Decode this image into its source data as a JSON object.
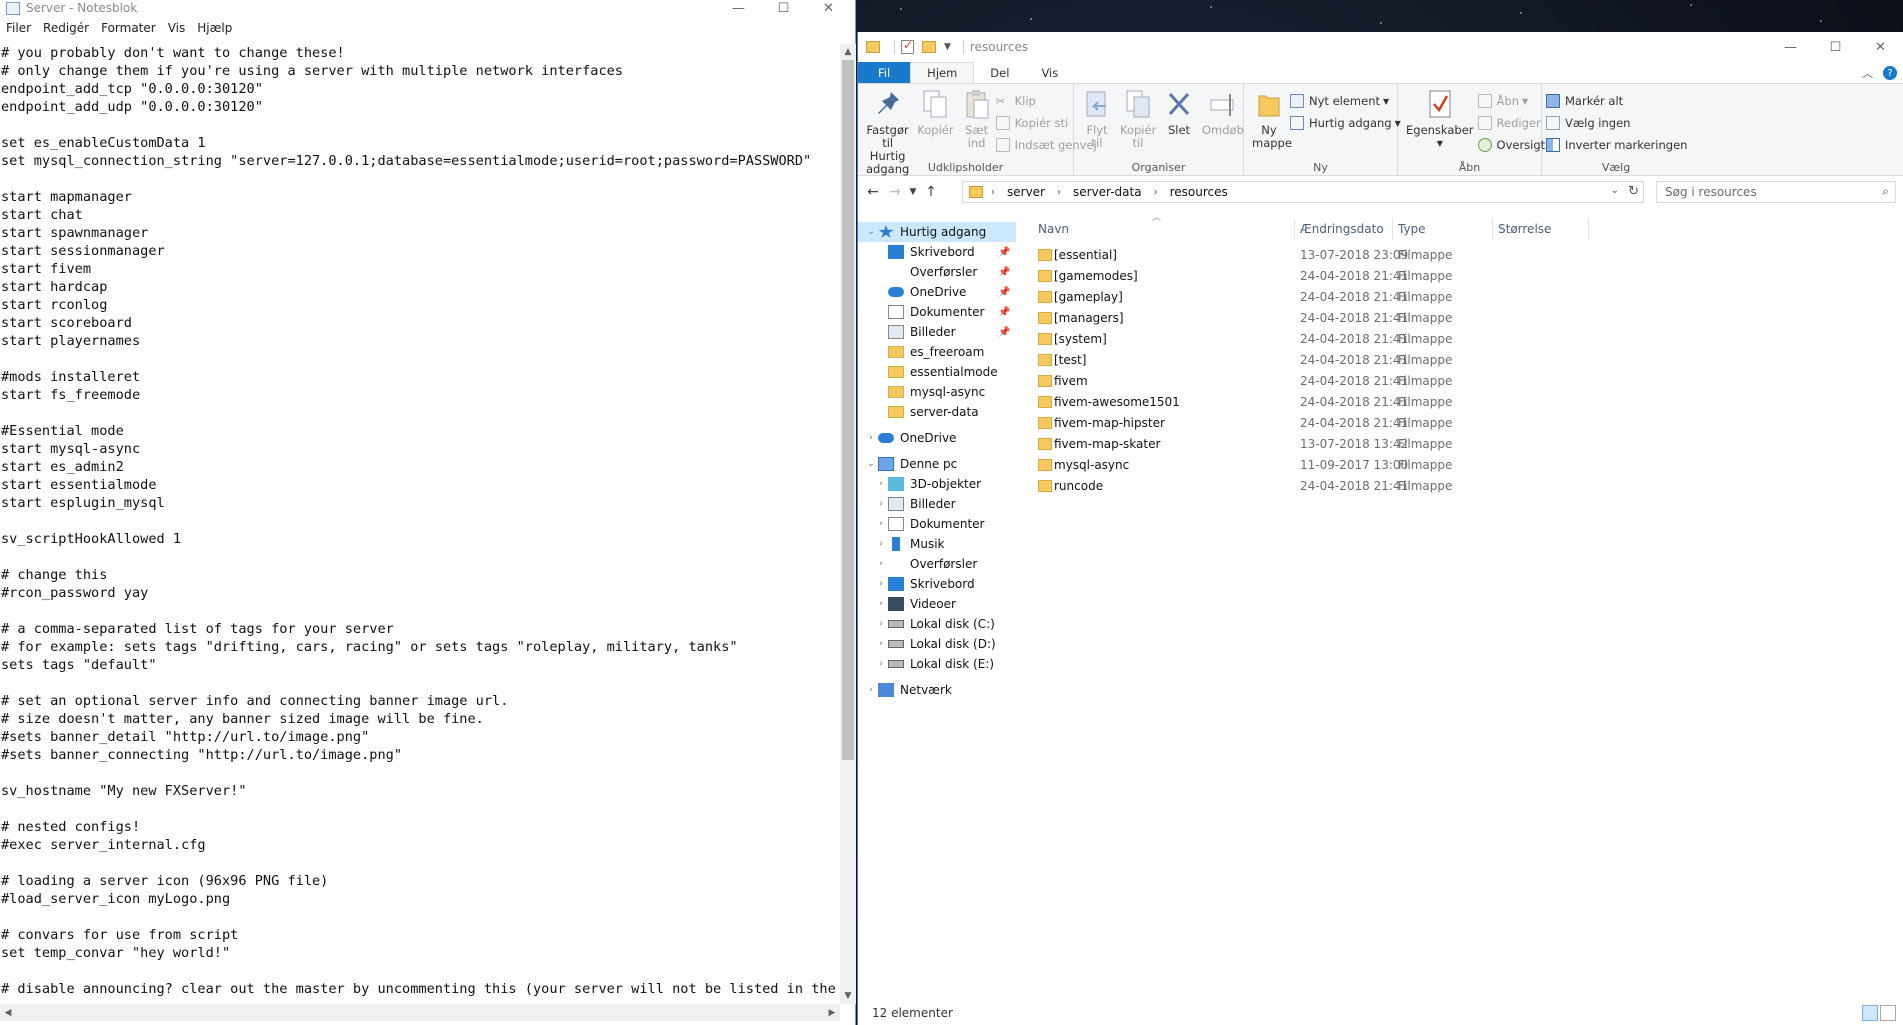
{
  "notepad": {
    "title": "Server - Notesblok",
    "menu": [
      "Filer",
      "Redigér",
      "Formater",
      "Vis",
      "Hjælp"
    ],
    "lines": [
      "# you probably don't want to change these!",
      "# only change them if you're using a server with multiple network interfaces",
      "endpoint_add_tcp \"0.0.0.0:30120\"",
      "endpoint_add_udp \"0.0.0.0:30120\"",
      "",
      "set es_enableCustomData 1",
      "set mysql_connection_string \"server=127.0.0.1;database=essentialmode;userid=root;password=PASSWORD\"",
      "",
      "start mapmanager",
      "start chat",
      "start spawnmanager",
      "start sessionmanager",
      "start fivem",
      "start hardcap",
      "start rconlog",
      "start scoreboard",
      "start playernames",
      "",
      "#mods installeret",
      "start fs_freemode",
      "",
      "#Essential mode",
      "start mysql-async",
      "start es_admin2",
      "start essentialmode",
      "start esplugin_mysql",
      "",
      "sv_scriptHookAllowed 1",
      "",
      "# change this",
      "#rcon_password yay",
      "",
      "# a comma-separated list of tags for your server",
      "# for example: sets tags \"drifting, cars, racing\" or sets tags \"roleplay, military, tanks\"",
      "sets tags \"default\"",
      "",
      "# set an optional server info and connecting banner image url.",
      "# size doesn't matter, any banner sized image will be fine.",
      "#sets banner_detail \"http://url.to/image.png\"",
      "#sets banner_connecting \"http://url.to/image.png\"",
      "",
      "sv_hostname \"My new FXServer!\"",
      "",
      "# nested configs!",
      "#exec server_internal.cfg",
      "",
      "# loading a server icon (96x96 PNG file)",
      "#load_server_icon myLogo.png",
      "",
      "# convars for use from script",
      "set temp_convar \"hey world!\"",
      "",
      "# disable announcing? clear out the master by uncommenting this (your server will not be listed in the se"
    ]
  },
  "explorer": {
    "title": "resources",
    "tabs": [
      "Fil",
      "Hjem",
      "Del",
      "Vis"
    ],
    "active_tab": "Hjem",
    "ribbon": {
      "clipboard": {
        "label": "Udklipsholder",
        "pin": "Fastgør til Hurtig adgang",
        "copy": "Kopiér",
        "paste": "Sæt ind",
        "cut": "Klip",
        "copy_path": "Kopiér sti",
        "paste_shortcut": "Indsæt genvej"
      },
      "organize": {
        "label": "Organiser",
        "move_to": "Flyt til",
        "copy_to": "Kopiér til",
        "delete": "Slet",
        "rename": "Omdøb"
      },
      "new": {
        "label": "Ny",
        "new_folder": "Ny mappe",
        "new_item": "Nyt element",
        "easy_access": "Hurtig adgang"
      },
      "open": {
        "label": "Åbn",
        "properties": "Egenskaber",
        "open": "Åbn",
        "edit": "Rediger",
        "history": "Oversigt"
      },
      "select": {
        "label": "Vælg",
        "select_all": "Markér alt",
        "select_none": "Vælg ingen",
        "invert": "Inverter markeringen"
      }
    },
    "breadcrumb": [
      "server",
      "server-data",
      "resources"
    ],
    "search_placeholder": "Søg i resources",
    "columns": [
      "Navn",
      "Ændringsdato",
      "Type",
      "Størrelse"
    ],
    "files": [
      {
        "name": "[essential]",
        "date": "13-07-2018 23:09",
        "type": "Filmappe"
      },
      {
        "name": "[gamemodes]",
        "date": "24-04-2018 21:41",
        "type": "Filmappe"
      },
      {
        "name": "[gameplay]",
        "date": "24-04-2018 21:41",
        "type": "Filmappe"
      },
      {
        "name": "[managers]",
        "date": "24-04-2018 21:41",
        "type": "Filmappe"
      },
      {
        "name": "[system]",
        "date": "24-04-2018 21:41",
        "type": "Filmappe"
      },
      {
        "name": "[test]",
        "date": "24-04-2018 21:41",
        "type": "Filmappe"
      },
      {
        "name": "fivem",
        "date": "24-04-2018 21:41",
        "type": "Filmappe"
      },
      {
        "name": "fivem-awesome1501",
        "date": "24-04-2018 21:41",
        "type": "Filmappe"
      },
      {
        "name": "fivem-map-hipster",
        "date": "24-04-2018 21:41",
        "type": "Filmappe"
      },
      {
        "name": "fivem-map-skater",
        "date": "13-07-2018 13:42",
        "type": "Filmappe"
      },
      {
        "name": "mysql-async",
        "date": "11-09-2017 13:00",
        "type": "Filmappe"
      },
      {
        "name": "runcode",
        "date": "24-04-2018 21:41",
        "type": "Filmappe"
      }
    ],
    "nav": {
      "quick_access": "Hurtig adgang",
      "quick_items": [
        "Skrivebord",
        "Overførsler",
        "OneDrive",
        "Dokumenter",
        "Billeder",
        "es_freeroam",
        "essentialmode",
        "mysql-async",
        "server-data"
      ],
      "onedrive": "OneDrive",
      "this_pc": "Denne pc",
      "pc_items": [
        "3D-objekter",
        "Billeder",
        "Dokumenter",
        "Musik",
        "Overførsler",
        "Skrivebord",
        "Videoer",
        "Lokal disk (C:)",
        "Lokal disk (D:)",
        "Lokal disk (E:)"
      ],
      "network": "Netværk"
    },
    "status": "12 elementer"
  },
  "colors": {
    "accent": "#1979ca",
    "folder": "#f5c95b",
    "selection": "#cce8ff"
  }
}
